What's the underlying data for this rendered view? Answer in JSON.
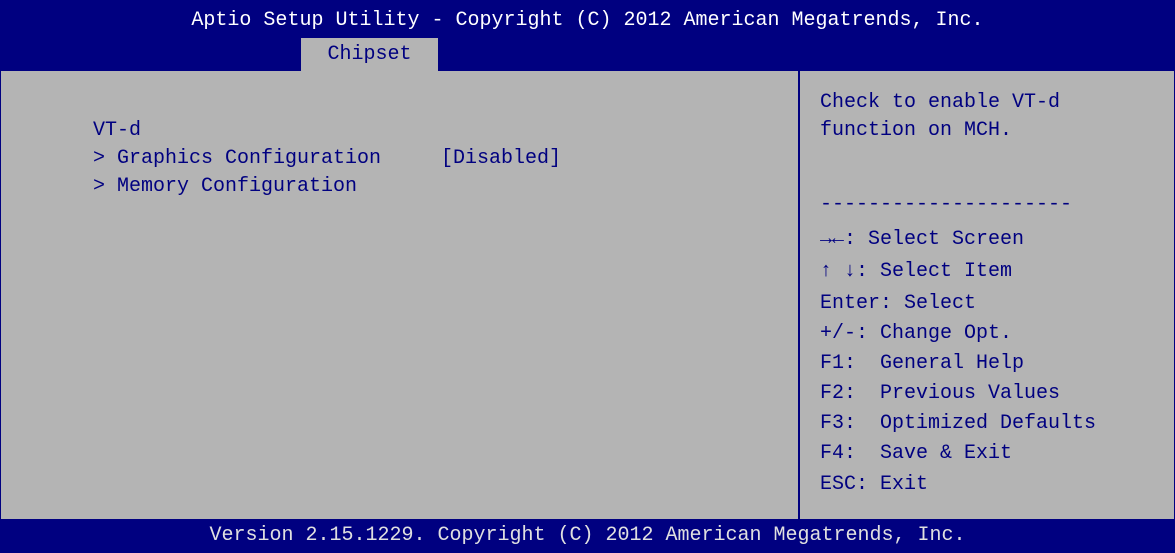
{
  "header": {
    "title": "Aptio Setup Utility - Copyright (C) 2012 American Megatrends, Inc.",
    "active_tab": "Chipset"
  },
  "settings": [
    {
      "label": "VT-d",
      "value": "[Disabled]"
    },
    {
      "label": "> Graphics Configuration",
      "value": ""
    },
    {
      "label": "> Memory Configuration",
      "value": ""
    }
  ],
  "help": {
    "description_line1": "Check to enable VT-d",
    "description_line2": "function on MCH.",
    "separator": "---------------------",
    "keys": [
      {
        "key": "→←",
        "text": ": Select Screen"
      },
      {
        "key": "↑ ↓",
        "text": ": Select Item"
      },
      {
        "key": "Enter",
        "text": ": Select"
      },
      {
        "key": "+/-",
        "text": ": Change Opt."
      },
      {
        "key": "F1",
        "text": ":  General Help"
      },
      {
        "key": "F2",
        "text": ":  Previous Values"
      },
      {
        "key": "F3",
        "text": ":  Optimized Defaults"
      },
      {
        "key": "F4",
        "text": ":  Save & Exit"
      },
      {
        "key": "ESC",
        "text": ": Exit"
      }
    ]
  },
  "footer": {
    "text": "Version 2.15.1229. Copyright (C) 2012 American Megatrends, Inc."
  },
  "colors": {
    "background": "#b4b4b4",
    "accent": "#000080",
    "header_text": "#ffffff"
  }
}
